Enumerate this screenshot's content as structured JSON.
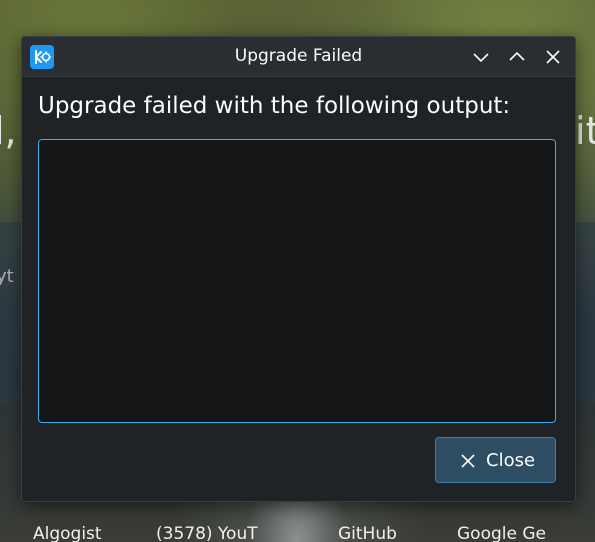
{
  "dialog": {
    "title": "Upgrade Failed",
    "app_icon": "kde-icon",
    "window_buttons": [
      "minimize-icon",
      "maximize-icon",
      "close-icon"
    ],
    "message": "Upgrade failed with the following output:",
    "output_text": "",
    "close_button": {
      "label": "Close",
      "icon": "close-icon"
    }
  },
  "background": {
    "bookmarks": [
      "Algogist",
      "(3578) YouT",
      "GitHub",
      "Google Ge"
    ],
    "partial_texts": [
      "l,",
      "it",
      "yt"
    ]
  },
  "colors": {
    "accent": "#3daee9",
    "dialog_bg": "#202326",
    "titlebar_bg": "#2a2e32",
    "output_bg": "#141618",
    "button_bg": "#2d4d62",
    "text": "#fcfcfc"
  }
}
